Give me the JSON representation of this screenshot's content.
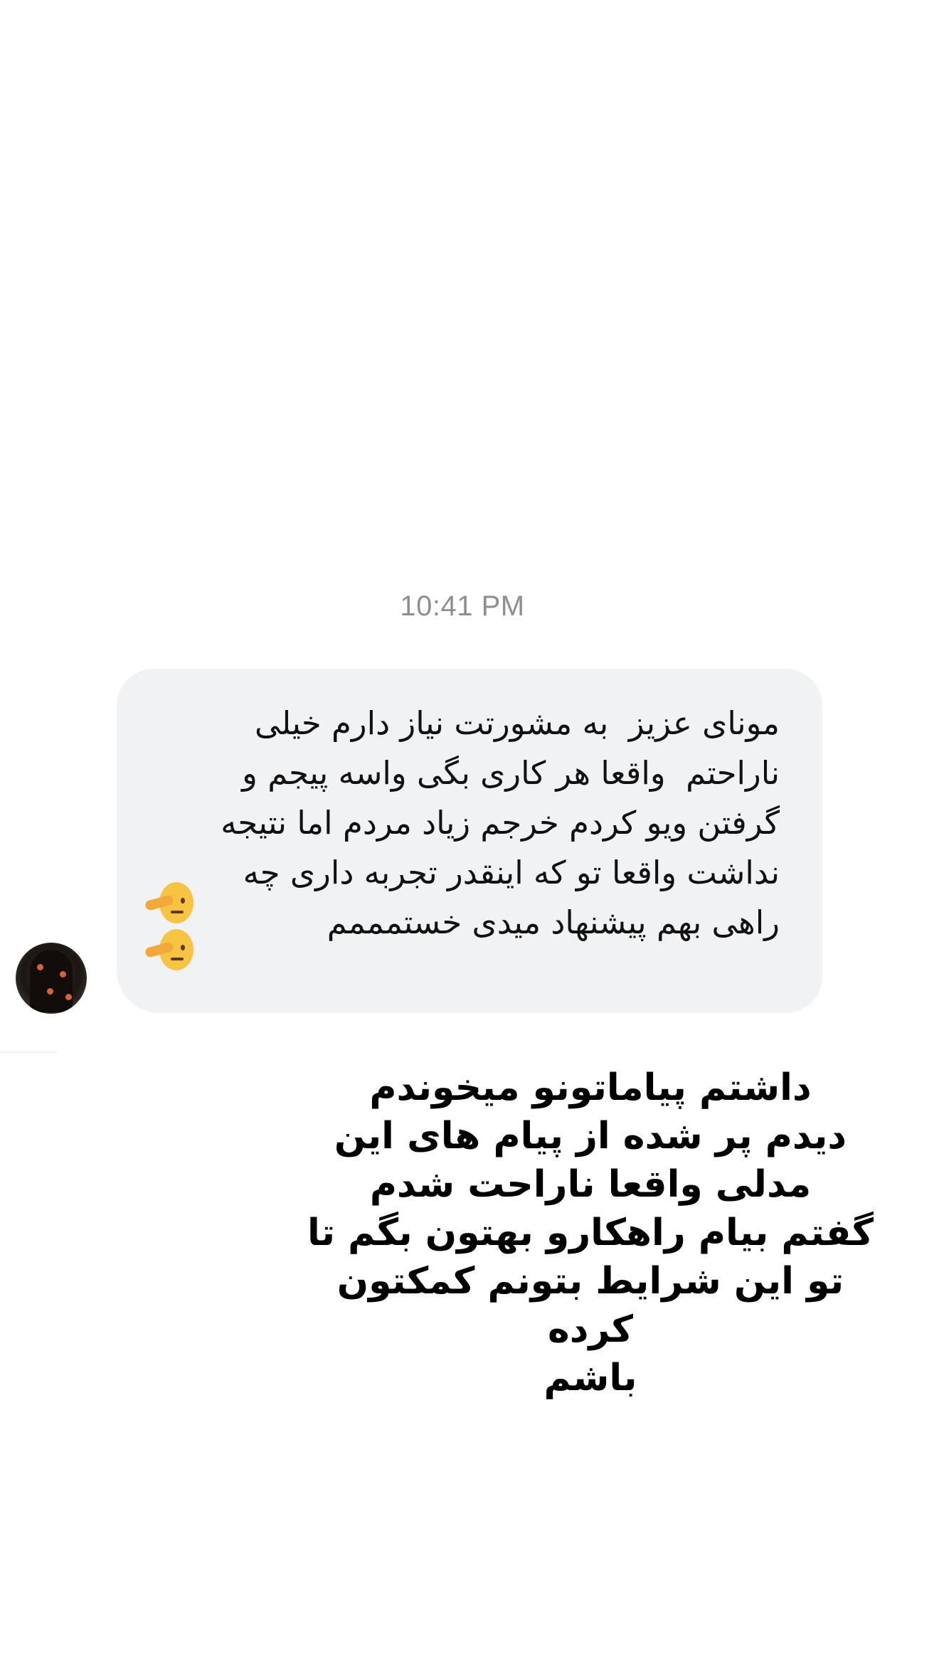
{
  "chat": {
    "timestamp": "10:41 PM",
    "message": {
      "text": "مونای عزیز  به مشورتت نیاز دارم خیلی\nناراحتم  واقعا هر کاری بگی واسه پیجم و\nگرفتن ویو کردم خرجم زیاد مردم اما نتیجه\nنداشت واقعا تو که اینقدر تجربه داری چه\nراهی بهم پیشنهاد میدی خستمممم",
      "emojis": [
        "thinking-face-icon",
        "thinking-face-icon"
      ]
    }
  },
  "overlay": {
    "caption": "داشتم پیاماتونو میخوندم\nدیدم پر شده از پیام های این\nمدلی واقعا ناراحت شدم\nگفتم بیام راهکارو بهتون بگم تا\nتو این شرایط بتونم کمکتون کرده\nباشم"
  }
}
